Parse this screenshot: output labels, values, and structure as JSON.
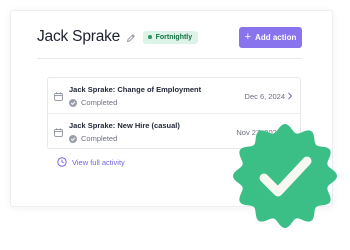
{
  "employee": {
    "name": "Jack Sprake",
    "pay_frequency": "Fortnightly"
  },
  "header": {
    "add_action_label": "Add action"
  },
  "activities": [
    {
      "title": "Jack Sprake: Change of Employment",
      "status": "Completed",
      "date": "Dec 6, 2024",
      "icon": "calendar-icon"
    },
    {
      "title": "Jack Sprake: New Hire (casual)",
      "status": "Completed",
      "date": "Nov 27, 2024",
      "icon": "calendar-icon"
    }
  ],
  "footer": {
    "view_full_activity": "View full activity"
  },
  "colors": {
    "accent": "#8a74ee",
    "badge_background": "#ddf3e7",
    "badge_text": "#177044",
    "success_seal": "#3cbf86"
  },
  "icons": [
    "pencil-icon",
    "plus-icon",
    "calendar-icon",
    "check-circle-icon",
    "chevron-right-icon",
    "clock-icon",
    "success-seal-icon"
  ]
}
